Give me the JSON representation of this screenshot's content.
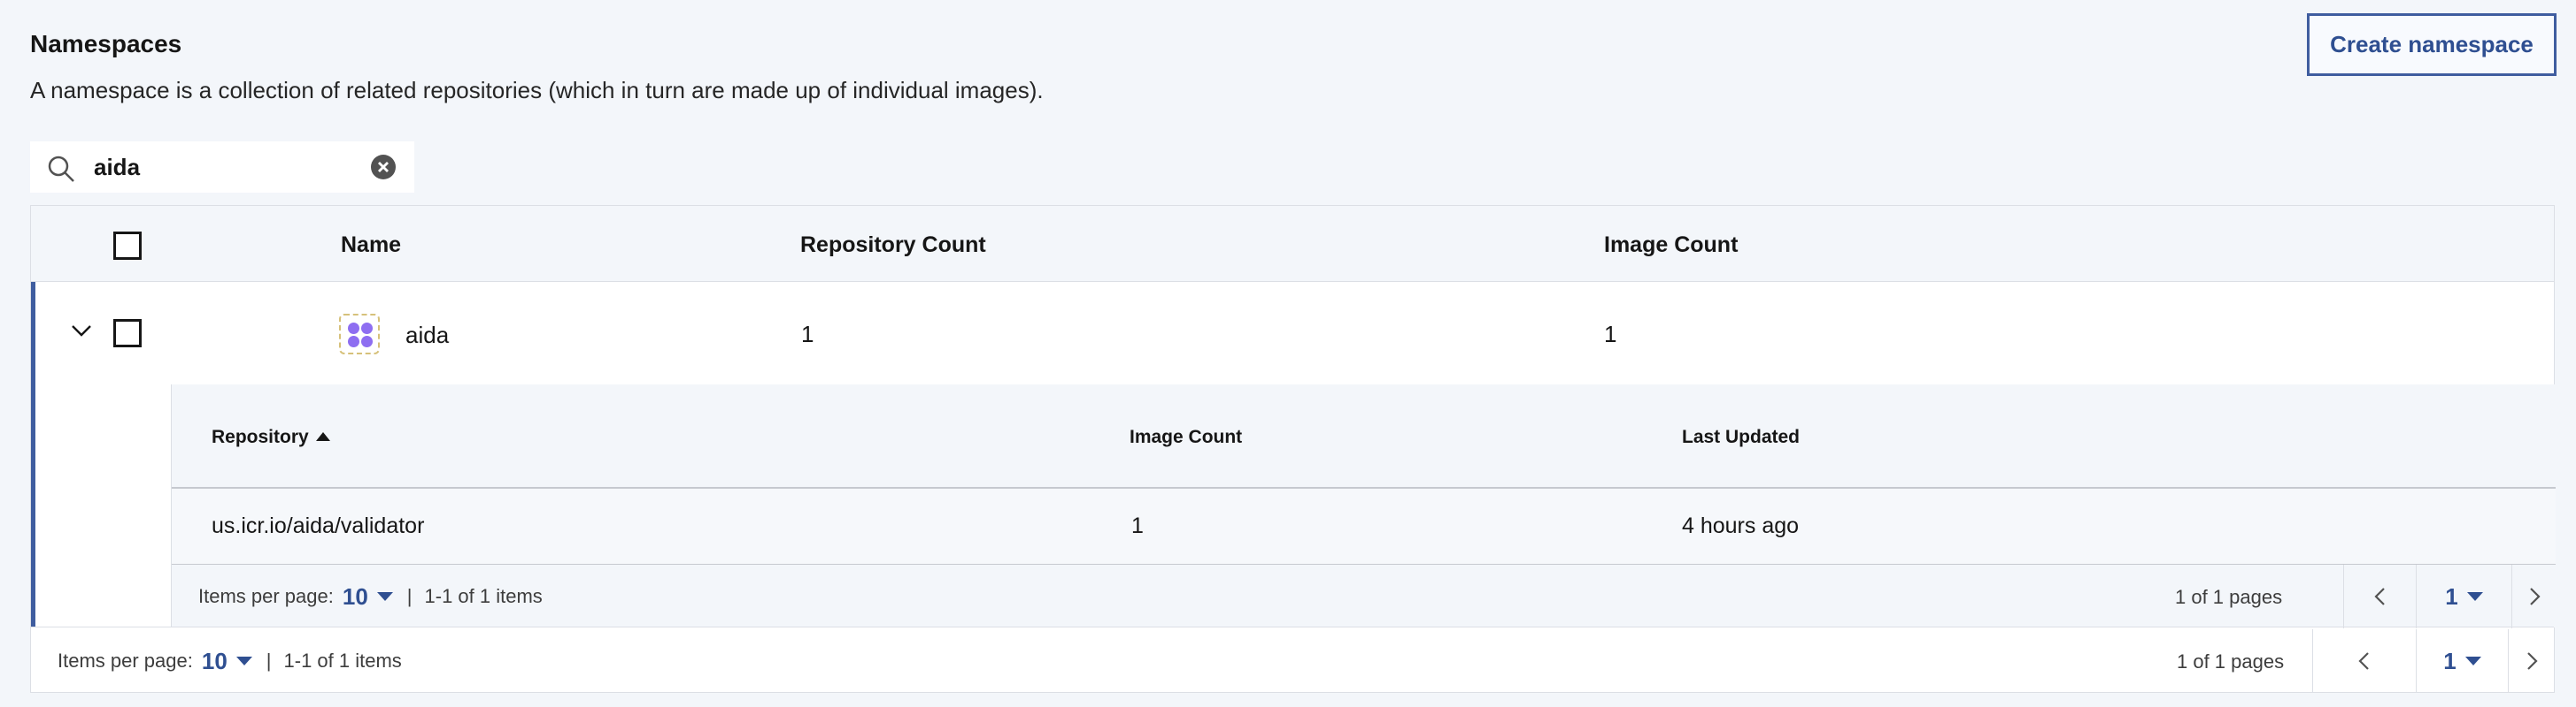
{
  "header": {
    "title": "Namespaces",
    "description": "A namespace is a collection of related repositories (which in turn are made up of individual images).",
    "create_label": "Create namespace"
  },
  "search": {
    "value": "aida",
    "placeholder": ""
  },
  "table": {
    "columns": [
      "Name",
      "Repository Count",
      "Image Count"
    ],
    "rows": [
      {
        "name": "aida",
        "repository_count": "1",
        "image_count": "1"
      }
    ]
  },
  "subtable": {
    "columns": [
      "Repository",
      "Image Count",
      "Last Updated"
    ],
    "rows": [
      {
        "repository": "us.icr.io/aida/validator",
        "image_count": "1",
        "last_updated": "4 hours ago"
      }
    ],
    "pagination": {
      "items_per_page_label": "Items per page:",
      "items_per_page": "10",
      "range": "1-1 of 1 items",
      "pages": "1 of 1 pages",
      "page": "1"
    }
  },
  "pagination": {
    "items_per_page_label": "Items per page:",
    "items_per_page": "10",
    "range": "1-1 of 1 items",
    "pages": "1 of 1 pages",
    "page": "1"
  },
  "colors": {
    "accent": "#3f5d9f",
    "link": "#2f4f91",
    "icon": "#8e6ef1"
  }
}
